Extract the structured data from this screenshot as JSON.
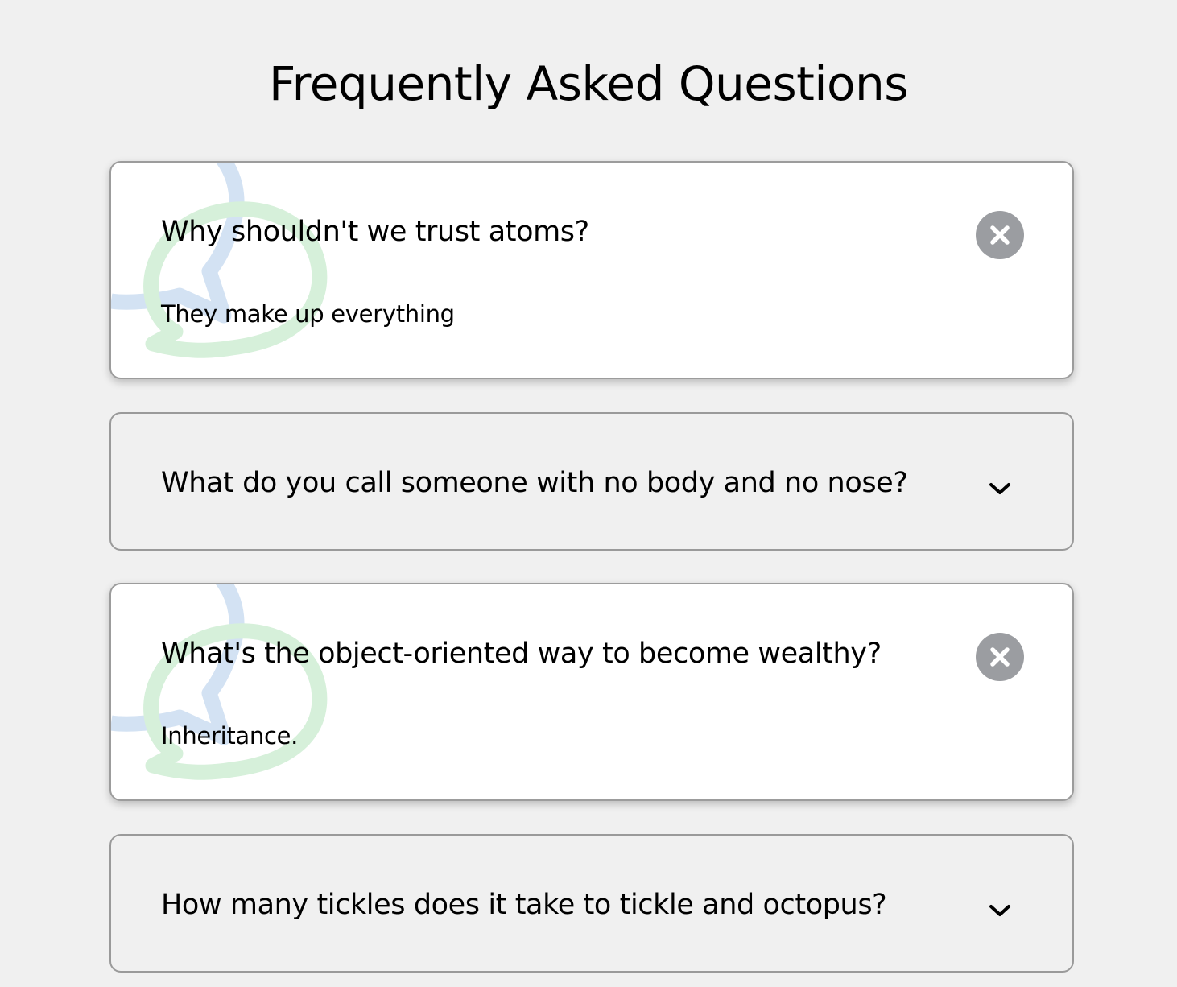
{
  "page": {
    "title": "Frequently Asked Questions"
  },
  "colors": {
    "background": "#f0f0f0",
    "card_open": "#ffffff",
    "close_button": "#9b9da1",
    "bubble_blue": "#d3e2f3",
    "bubble_green": "#d6f0da"
  },
  "faqs": [
    {
      "question": "Why shouldn't we trust atoms?",
      "answer": "They make up everything",
      "state": "open",
      "toggle_icon": "close-icon"
    },
    {
      "question": "What do you call someone with no body and no nose?",
      "state": "collapsed",
      "toggle_icon": "chevron-down-icon"
    },
    {
      "question": "What's the object-oriented way to become wealthy?",
      "answer": "Inheritance.",
      "state": "open",
      "toggle_icon": "close-icon"
    },
    {
      "question": "How many tickles does it take to tickle and octopus?",
      "state": "collapsed",
      "toggle_icon": "chevron-down-icon"
    }
  ]
}
